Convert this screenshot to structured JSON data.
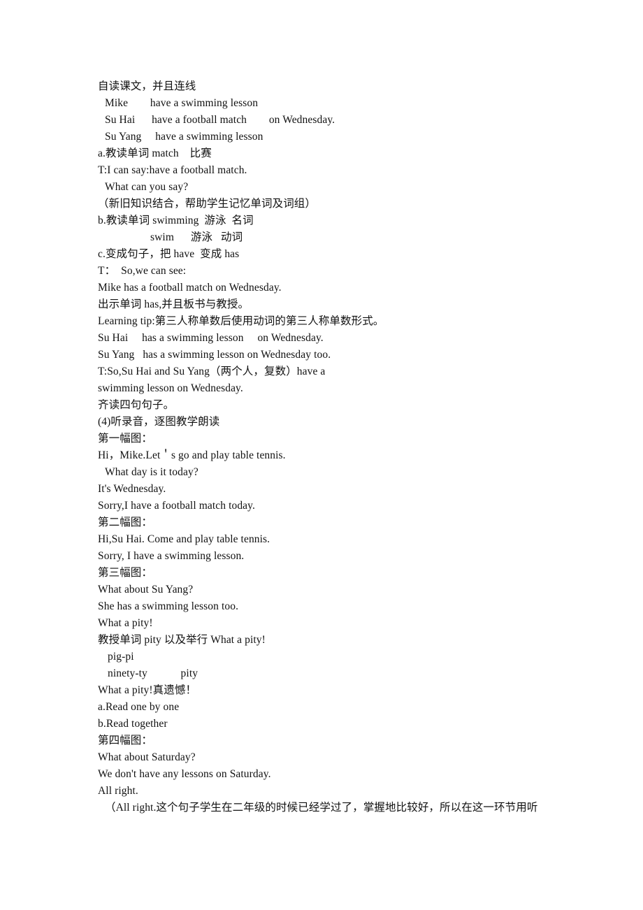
{
  "document": {
    "page_background": "#ffffff",
    "text_color": "#111111",
    "lines": [
      {
        "text": "自读课文，并且连线",
        "indent": "ind-0"
      },
      {
        "text": "Mike        have a swimming lesson",
        "indent": "ind-1"
      },
      {
        "text": "Su Hai      have a football match        on Wednesday.",
        "indent": "ind-1"
      },
      {
        "text": "Su Yang     have a swimming lesson",
        "indent": "ind-1"
      },
      {
        "text": "a.教读单词 match    比赛",
        "indent": "ind-0"
      },
      {
        "text": "T:I can say:have a football match.",
        "indent": "ind-0"
      },
      {
        "text": "What can you say?",
        "indent": "ind-1"
      },
      {
        "text": "（新旧知识结合，帮助学生记忆单词及词组）",
        "indent": "ind-0"
      },
      {
        "text": "b.教读单词 swimming  游泳  名词",
        "indent": "ind-0"
      },
      {
        "text": "swim      游泳   动词",
        "indent": "ind-3"
      },
      {
        "text": "c.变成句子，把 have  变成 has",
        "indent": "ind-0"
      },
      {
        "text": "T：  So,we can see:",
        "indent": "ind-0"
      },
      {
        "text": "Mike has a football match on Wednesday.",
        "indent": "ind-0"
      },
      {
        "text": "出示单词 has,并且板书与教授。",
        "indent": "ind-0"
      },
      {
        "text": "Learning tip:第三人称单数后使用动词的第三人称单数形式。",
        "indent": "ind-0"
      },
      {
        "text": "Su Hai     has a swimming lesson     on Wednesday.",
        "indent": "ind-0"
      },
      {
        "text": "Su Yang   has a swimming lesson on Wednesday too.",
        "indent": "ind-0"
      },
      {
        "text": "T:So,Su Hai and Su Yang（两个人，复数）have a",
        "indent": "ind-0"
      },
      {
        "text": "swimming lesson on Wednesday.",
        "indent": "ind-0"
      },
      {
        "text": "齐读四句句子。",
        "indent": "ind-0"
      },
      {
        "text": "(4)听录音，逐图教学朗读",
        "indent": "ind-0"
      },
      {
        "text": "第一幅图：",
        "indent": "ind-0"
      },
      {
        "text": "Hi，Mike.Let＇s go and play table tennis.",
        "indent": "ind-0"
      },
      {
        "text": "What day is it today?",
        "indent": "ind-1"
      },
      {
        "text": "It's Wednesday.",
        "indent": "ind-0"
      },
      {
        "text": "Sorry,I have a football match today.",
        "indent": "ind-0"
      },
      {
        "text": "第二幅图：",
        "indent": "ind-0"
      },
      {
        "text": "Hi,Su Hai. Come and play table tennis.",
        "indent": "ind-0"
      },
      {
        "text": "Sorry, I have a swimming lesson.",
        "indent": "ind-0"
      },
      {
        "text": "第三幅图：",
        "indent": "ind-0"
      },
      {
        "text": "What about Su Yang?",
        "indent": "ind-0"
      },
      {
        "text": "She has a swimming lesson too.",
        "indent": "ind-0"
      },
      {
        "text": "What a pity!",
        "indent": "ind-0"
      },
      {
        "text": "教授单词 pity 以及举行 What a pity!",
        "indent": "ind-0"
      },
      {
        "text": "pig-pi",
        "indent": "ind-2"
      },
      {
        "text": "ninety-ty            pity",
        "indent": "ind-2"
      },
      {
        "text": "What a pity!真遗憾！",
        "indent": "ind-0"
      },
      {
        "text": "a.Read one by one",
        "indent": "ind-0"
      },
      {
        "text": "b.Read together",
        "indent": "ind-0"
      },
      {
        "text": "第四幅图：",
        "indent": "ind-0"
      },
      {
        "text": "What about Saturday?",
        "indent": "ind-0"
      },
      {
        "text": "We don't have any lessons on Saturday.",
        "indent": "ind-0"
      },
      {
        "text": "All right.",
        "indent": "ind-0"
      },
      {
        "text": "（All right.这个句子学生在二年级的时候已经学过了，掌握地比较好，所以在这一环节用听",
        "indent": "ind-1"
      }
    ]
  }
}
